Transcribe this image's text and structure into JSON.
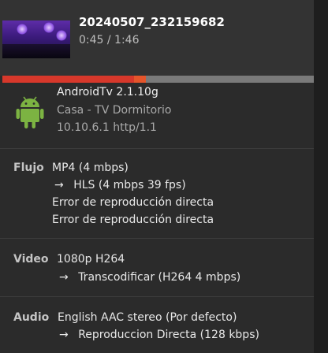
{
  "media": {
    "title": "20240507_232159682",
    "time": "0:45 / 1:46",
    "progress_played": 0.424,
    "progress_buffered": 0.46
  },
  "device": {
    "app": "AndroidTv 2.1.10g",
    "name": "Casa - TV Dormitorio",
    "address": "10.10.6.1 http/1.1"
  },
  "stream": {
    "label": "Flujo",
    "container": "MP4 (4 mbps)",
    "transcode": "HLS (4 mbps 39 fps)",
    "error1": "Error de reproducción directa",
    "error2": "Error de reproducción directa"
  },
  "video": {
    "label": "Video",
    "source": "1080p H264",
    "target": "Transcodificar (H264 4 mbps)"
  },
  "audio": {
    "label": "Audio",
    "source": "English AAC stereo (Por defecto)",
    "target": "Reproduccion Directa (128 kbps)"
  },
  "arrow": "→",
  "colors": {
    "progress_played": "#d7382b",
    "progress_buffer": "#e5552b",
    "android_green": "#7cb342"
  }
}
